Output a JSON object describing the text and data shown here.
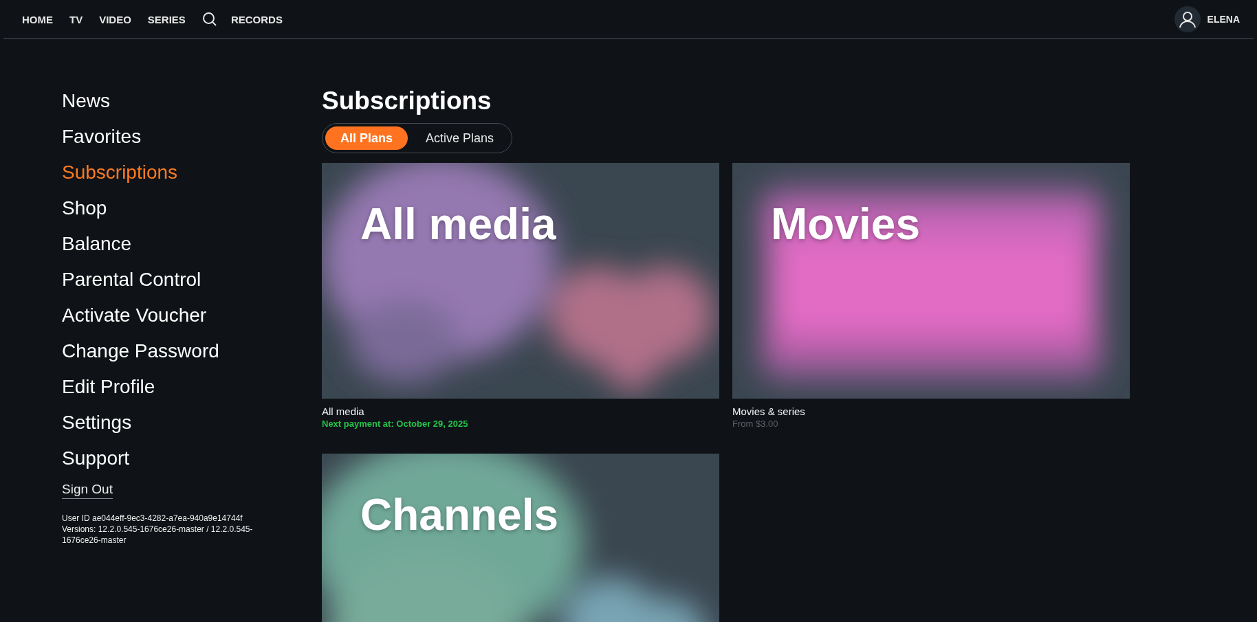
{
  "nav": {
    "items": [
      {
        "kind": "link",
        "label": "HOME"
      },
      {
        "kind": "link",
        "label": "TV"
      },
      {
        "kind": "link",
        "label": "VIDEO"
      },
      {
        "kind": "link",
        "label": "SERIES"
      },
      {
        "kind": "search"
      },
      {
        "kind": "link",
        "label": "RECORDS"
      }
    ],
    "user": {
      "name": "ELENA"
    }
  },
  "sidebar": {
    "items": [
      {
        "label": "News",
        "selected": false
      },
      {
        "label": "Favorites",
        "selected": false
      },
      {
        "label": "Subscriptions",
        "selected": true
      },
      {
        "label": "Shop",
        "selected": false
      },
      {
        "label": "Balance",
        "selected": false
      },
      {
        "label": "Parental Control",
        "selected": false
      },
      {
        "label": "Activate Voucher",
        "selected": false
      },
      {
        "label": "Change Password",
        "selected": false
      },
      {
        "label": "Edit Profile",
        "selected": false
      },
      {
        "label": "Settings",
        "selected": false
      },
      {
        "label": "Support",
        "selected": false
      }
    ],
    "sign_out": "Sign Out",
    "user_id": "User ID ae044eff-9ec3-4282-a7ea-940a9e14744f",
    "versions": "Versions: 12.2.0.545-1676ce26-master / 12.2.0.545-1676ce26-master"
  },
  "title": "Subscriptions",
  "tabs": [
    {
      "label": "All Plans",
      "selected": true
    },
    {
      "label": "Active Plans",
      "selected": false
    }
  ],
  "cards": [
    {
      "banner": "All media",
      "name": "All media",
      "kind": "active",
      "detail": "Next payment at: October 29, 2025"
    },
    {
      "banner": "Movies",
      "name": "Movies & series",
      "kind": "price",
      "detail": "From $3.00"
    },
    {
      "banner": "Channels"
    }
  ]
}
